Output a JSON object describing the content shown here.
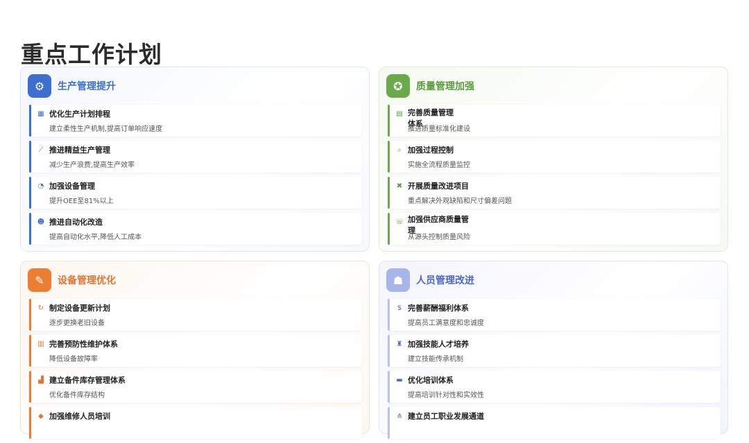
{
  "page": {
    "title": "重点工作计划"
  },
  "panels": [
    {
      "title": "生产管理提升",
      "icon": "gears-icon",
      "items": [
        {
          "title": "优化生产计划排程",
          "desc": "建立柔性生产机制,提高订单响应速度",
          "icon": "calendar-icon"
        },
        {
          "title": "推进精益生产管理",
          "desc": "减少生产浪费,提高生产效率",
          "icon": "line-chart-icon"
        },
        {
          "title": "加强设备管理",
          "desc": "提升OEE至81%以上",
          "icon": "gauge-icon"
        },
        {
          "title": "推进自动化改造",
          "desc": "提高自动化水平,降低人工成本",
          "icon": "robot-icon"
        }
      ]
    },
    {
      "title": "质量管理加强",
      "icon": "award-icon",
      "items": [
        {
          "title": "完善质量管理体系",
          "desc": "推进质量标准化建设",
          "icon": "document-icon"
        },
        {
          "title": "加强过程控制",
          "desc": "实施全流程质量监控",
          "icon": "search-icon"
        },
        {
          "title": "开展质量改进项目",
          "desc": "重点解决外观缺陷和尺寸偏差问题",
          "icon": "tools-icon"
        },
        {
          "title": "加强供应商质量管理",
          "desc": "从源头控制质量风险",
          "icon": "handshake-icon"
        }
      ]
    },
    {
      "title": "设备管理优化",
      "icon": "wrench-icon",
      "items": [
        {
          "title": "制定设备更新计划",
          "desc": "逐步更换老旧设备",
          "icon": "refresh-icon"
        },
        {
          "title": "完善预防性维护体系",
          "desc": "降低设备故障率",
          "icon": "clipboard-icon"
        },
        {
          "title": "建立备件库存管理体系",
          "desc": "优化备件库存结构",
          "icon": "boxes-icon"
        },
        {
          "title": "加强维修人员培训",
          "desc": "",
          "icon": "graduation-cap-icon"
        }
      ]
    },
    {
      "title": "人员管理改进",
      "icon": "users-icon",
      "items": [
        {
          "title": "完善薪酬福利体系",
          "desc": "提高员工满意度和忠诚度",
          "icon": "dollar-icon"
        },
        {
          "title": "加强技能人才培养",
          "desc": "建立技能传承机制",
          "icon": "teacher-icon"
        },
        {
          "title": "优化培训体系",
          "desc": "提高培训针对性和实效性",
          "icon": "presentation-icon"
        },
        {
          "title": "建立员工职业发展通道",
          "desc": "",
          "icon": "network-icon"
        }
      ]
    }
  ]
}
